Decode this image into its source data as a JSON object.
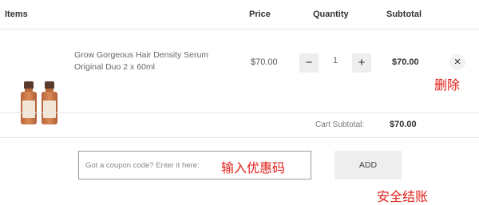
{
  "header": {
    "items": "Items",
    "price": "Price",
    "quantity": "Quantity",
    "subtotal": "Subtotal"
  },
  "item": {
    "name_line1": "Grow Gorgeous Hair Density Serum",
    "name_line2": "Original Duo 2 x 60ml",
    "price": "$70.00",
    "quantity": "1",
    "subtotal": "$70.00",
    "minus": "−",
    "plus": "+",
    "remove": "×"
  },
  "cart": {
    "subtotal_label": "Cart Subtotal:",
    "subtotal_value": "$70.00"
  },
  "coupon": {
    "placeholder": "Got a coupon code? Enter it here:",
    "add_label": "ADD"
  },
  "annotations": {
    "delete": "删除",
    "enter_coupon": "输入优惠码",
    "secure_checkout": "安全结账"
  },
  "colors": {
    "annotation": "#e0201a",
    "button_bg": "#eeeeee"
  }
}
